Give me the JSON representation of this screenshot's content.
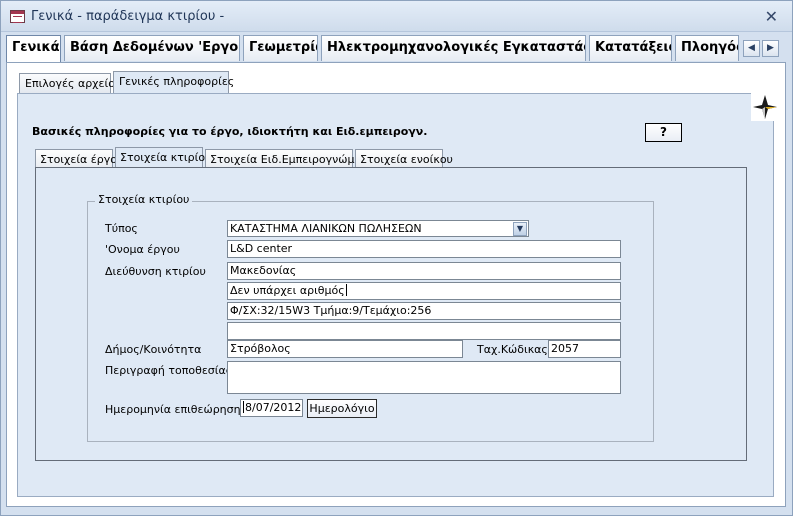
{
  "window": {
    "title": "Γενικά - παράδειγμα κτιρίου -"
  },
  "top_tabs": [
    {
      "label": "Γενικά"
    },
    {
      "label": "Βάση Δεδομένων 'Εργου"
    },
    {
      "label": "Γεωμετρία"
    },
    {
      "label": "Ηλεκτρομηχανολογικές Εγκαταστάσεις"
    },
    {
      "label": "Κατατάξεις"
    },
    {
      "label": "Πλοηγός"
    }
  ],
  "sub_tabs": [
    {
      "label": "Επιλογές αρχείου"
    },
    {
      "label": "Γενικές πληροφορίες"
    }
  ],
  "heading": "Βασικές πληροφορίες για το έργο, ιδιοκτήτη και Ειδ.εμπειρογν.",
  "help_button": "?",
  "inner_tabs": [
    {
      "label": "Στοιχεία έργου"
    },
    {
      "label": "Στοιχεία κτιρίου"
    },
    {
      "label": "Στοιχεία Ειδ.Εμπειρογνώμονα"
    },
    {
      "label": "Στοιχεία ενοίκου"
    }
  ],
  "group": {
    "title": "Στοιχεία κτιρίου"
  },
  "form": {
    "type_label": "Τύπος",
    "type_value": "ΚΑΤΑΣΤΗΜΑ ΛΙΑΝΙΚΩΝ ΠΩΛΗΣΕΩΝ",
    "project_name_label": "'Ονομα έργου",
    "project_name_value": "L&D center",
    "address_label": "Διεύθυνση κτιρίου",
    "address_line1": "Μακεδονίας",
    "address_line2": "Δεν υπάρχει αριθμός",
    "address_line3": "Φ/ΣΧ:32/15W3  Τμήμα:9/Τεμάχιο:256",
    "address_line4": "",
    "municipality_label": "Δήμος/Κοινότητα",
    "municipality_value": "Στρόβολος",
    "postal_label": "Ταχ.Κώδικας",
    "postal_value": "2057",
    "location_desc_label": "Περιγραφή τοποθεσίας",
    "location_desc_value": "",
    "inspection_date_label": "Ημερομηνία επιθεώρησης",
    "inspection_date_value": "8/07/2012",
    "calendar_button": "Ημερολόγιο"
  },
  "icons": {
    "window_icon": "form-icon",
    "close": "close-icon",
    "nav_left": "arrow-left-icon",
    "nav_right": "arrow-right-icon",
    "logo": "star-logo-icon",
    "combo": "chevron-down-icon"
  }
}
